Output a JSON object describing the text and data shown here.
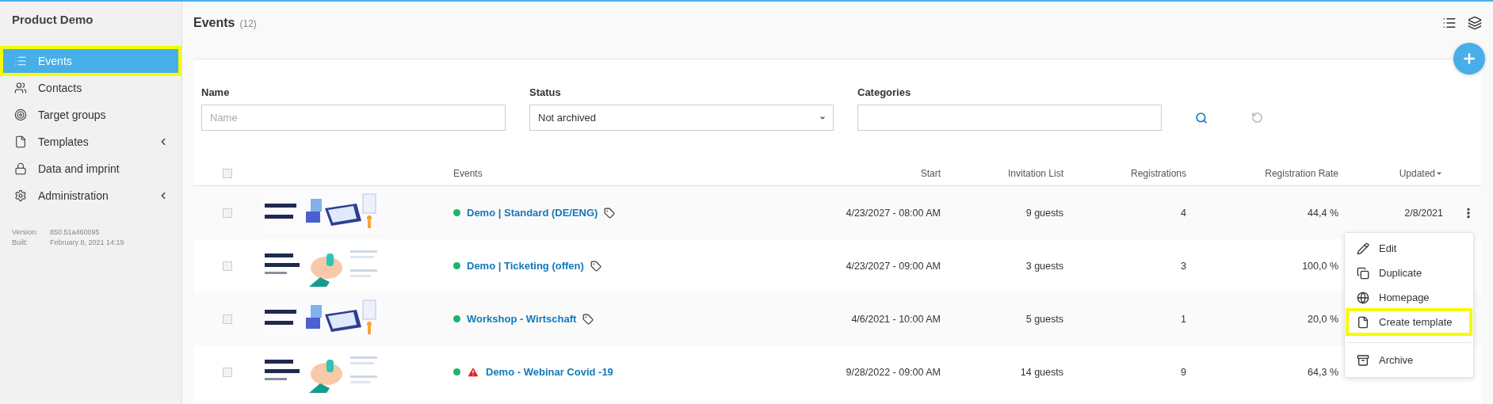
{
  "sidebar": {
    "title": "Product Demo",
    "items": [
      {
        "label": "Events",
        "selected": true,
        "highlighted": true,
        "has_submenu": false
      },
      {
        "label": "Contacts",
        "selected": false,
        "highlighted": false,
        "has_submenu": false
      },
      {
        "label": "Target groups",
        "selected": false,
        "highlighted": false,
        "has_submenu": false
      },
      {
        "label": "Templates",
        "selected": false,
        "highlighted": false,
        "has_submenu": true
      },
      {
        "label": "Data and imprint",
        "selected": false,
        "highlighted": false,
        "has_submenu": false
      },
      {
        "label": "Administration",
        "selected": false,
        "highlighted": false,
        "has_submenu": true
      }
    ],
    "version": {
      "label": "Version:",
      "value": "850.51a460095"
    },
    "built": {
      "label": "Built:",
      "value": "February 8, 2021 14:19"
    }
  },
  "header": {
    "title": "Events",
    "count": "(12)"
  },
  "filters": [
    {
      "label": "Name",
      "kind": "text",
      "placeholder": "Name"
    },
    {
      "label": "Status",
      "kind": "select",
      "value": "Not archived"
    },
    {
      "label": "Categories",
      "kind": "text"
    }
  ],
  "table": {
    "select_all_checked": false,
    "columns": [
      {
        "label": "Events",
        "sorted": false
      },
      {
        "label": "Start",
        "sorted": false
      },
      {
        "label": "Invitation List",
        "sorted": false
      },
      {
        "label": "Registrations",
        "sorted": false
      },
      {
        "label": "Registration Rate",
        "sorted": false
      },
      {
        "label": "Updated",
        "sorted": true
      }
    ],
    "rows": [
      {
        "checked": false,
        "color": "#1db46c",
        "warning": false,
        "name": "Demo | Standard (DE/ENG)",
        "tagged": true,
        "start": "4/23/2027 - 08:00 AM",
        "invitation": "9 guests",
        "registrations": "4",
        "rate": "44,4 %",
        "updated": "2/8/2021",
        "menu_open": true
      },
      {
        "checked": false,
        "color": "#1db46c",
        "warning": false,
        "name": "Demo | Ticketing (offen)",
        "tagged": true,
        "start": "4/23/2027 - 09:00 AM",
        "invitation": "3 guests",
        "registrations": "3",
        "rate": "100,0 %",
        "menu_open": false
      },
      {
        "checked": false,
        "color": "#1db46c",
        "warning": false,
        "name": "Workshop - Wirtschaft",
        "tagged": true,
        "start": "4/6/2021 - 10:00 AM",
        "invitation": "5 guests",
        "registrations": "1",
        "rate": "20,0 %",
        "menu_open": false
      },
      {
        "checked": false,
        "color": "#1db46c",
        "warning": true,
        "name": "Demo - Webinar Covid -19",
        "tagged": false,
        "start": "9/28/2022 - 09:00 AM",
        "invitation": "14 guests",
        "registrations": "9",
        "rate": "64,3 %",
        "menu_open": false
      }
    ]
  },
  "row_menu": {
    "items": [
      {
        "label": "Edit",
        "highlighted": false,
        "divider_before": false
      },
      {
        "label": "Duplicate",
        "highlighted": false,
        "divider_before": false
      },
      {
        "label": "Homepage",
        "highlighted": false,
        "divider_before": false
      },
      {
        "label": "Create template",
        "highlighted": true,
        "divider_before": false
      },
      {
        "label": "Archive",
        "highlighted": false,
        "divider_before": true
      }
    ]
  }
}
